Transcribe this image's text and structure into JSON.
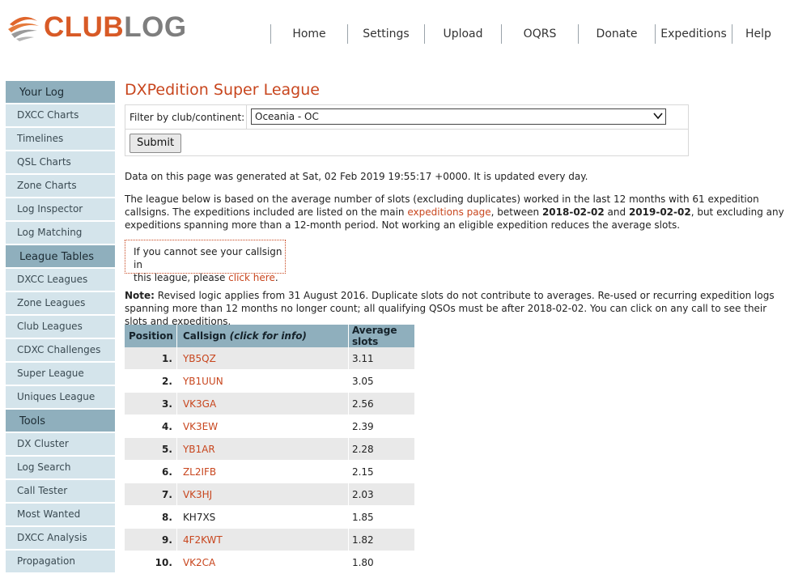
{
  "header": {
    "logo_club": "CLUB",
    "logo_log": "LOG",
    "brand_colors": {
      "orange": "#d85a26",
      "grey": "#7e7e7e"
    },
    "nav": [
      "Home",
      "Settings",
      "Upload",
      "OQRS",
      "Donate",
      "Expeditions",
      "Help"
    ]
  },
  "sidebar": {
    "sections": [
      {
        "title": "Your Log",
        "items": [
          "DXCC Charts",
          "Timelines",
          "QSL Charts",
          "Zone Charts",
          "Log Inspector",
          "Log Matching"
        ]
      },
      {
        "title": "League Tables",
        "items": [
          "DXCC Leagues",
          "Zone Leagues",
          "Club Leagues",
          "CDXC Challenges",
          "Super League",
          "Uniques League"
        ]
      },
      {
        "title": "Tools",
        "items": [
          "DX Cluster",
          "Log Search",
          "Call Tester",
          "Most Wanted",
          "DXCC Analysis",
          "Propagation"
        ]
      }
    ]
  },
  "main": {
    "title": "DXPedition Super League",
    "filter": {
      "label": "Filter by club/continent:",
      "selected": "Oceania - OC",
      "submit": "Submit"
    },
    "generated": "Data on this page was generated at Sat, 02 Feb 2019 19:55:17 +0000. It is updated every day.",
    "desc": {
      "part1": "The league below is based on the average number of slots (excluding duplicates) worked in the last 12 months with 61 expedition callsigns. The expeditions included are listed on the main ",
      "link": "expeditions page",
      "part2": ", between ",
      "date1": "2018-02-02",
      "part3": " and ",
      "date2": "2019-02-02",
      "part4": ", but excluding any expeditions spanning more than a 12-month period. Not working an eligible expedition reduces the average slots."
    },
    "notice": {
      "line1": "If you cannot see your callsign in",
      "line2": "this league, please ",
      "link": "click here",
      "end": "."
    },
    "note": {
      "label": "Note:",
      "text": " Revised logic applies from 31 August 2016. Duplicate slots do not contribute to averages. Re-used or recurring expedition logs spanning more than 12 months no longer count; all qualifying QSOs must be after 2018-02-02. You can click on any call to see their slots and expeditions."
    },
    "table": {
      "headers": {
        "position": "Position",
        "callsign": "Callsign",
        "callsign_hint": "(click for info)",
        "avg": "Average slots"
      },
      "rows": [
        {
          "pos": "1.",
          "call": "YB5QZ",
          "avg": "3.11",
          "link": true
        },
        {
          "pos": "2.",
          "call": "YB1UUN",
          "avg": "3.05",
          "link": true
        },
        {
          "pos": "3.",
          "call": "VK3GA",
          "avg": "2.56",
          "link": true
        },
        {
          "pos": "4.",
          "call": "VK3EW",
          "avg": "2.39",
          "link": true
        },
        {
          "pos": "5.",
          "call": "YB1AR",
          "avg": "2.28",
          "link": true
        },
        {
          "pos": "6.",
          "call": "ZL2IFB",
          "avg": "2.15",
          "link": true
        },
        {
          "pos": "7.",
          "call": "VK3HJ",
          "avg": "2.03",
          "link": true
        },
        {
          "pos": "8.",
          "call": "KH7XS",
          "avg": "1.85",
          "link": false
        },
        {
          "pos": "9.",
          "call": "4F2KWT",
          "avg": "1.82",
          "link": true
        },
        {
          "pos": "10.",
          "call": "VK2CA",
          "avg": "1.80",
          "link": true
        }
      ]
    }
  }
}
